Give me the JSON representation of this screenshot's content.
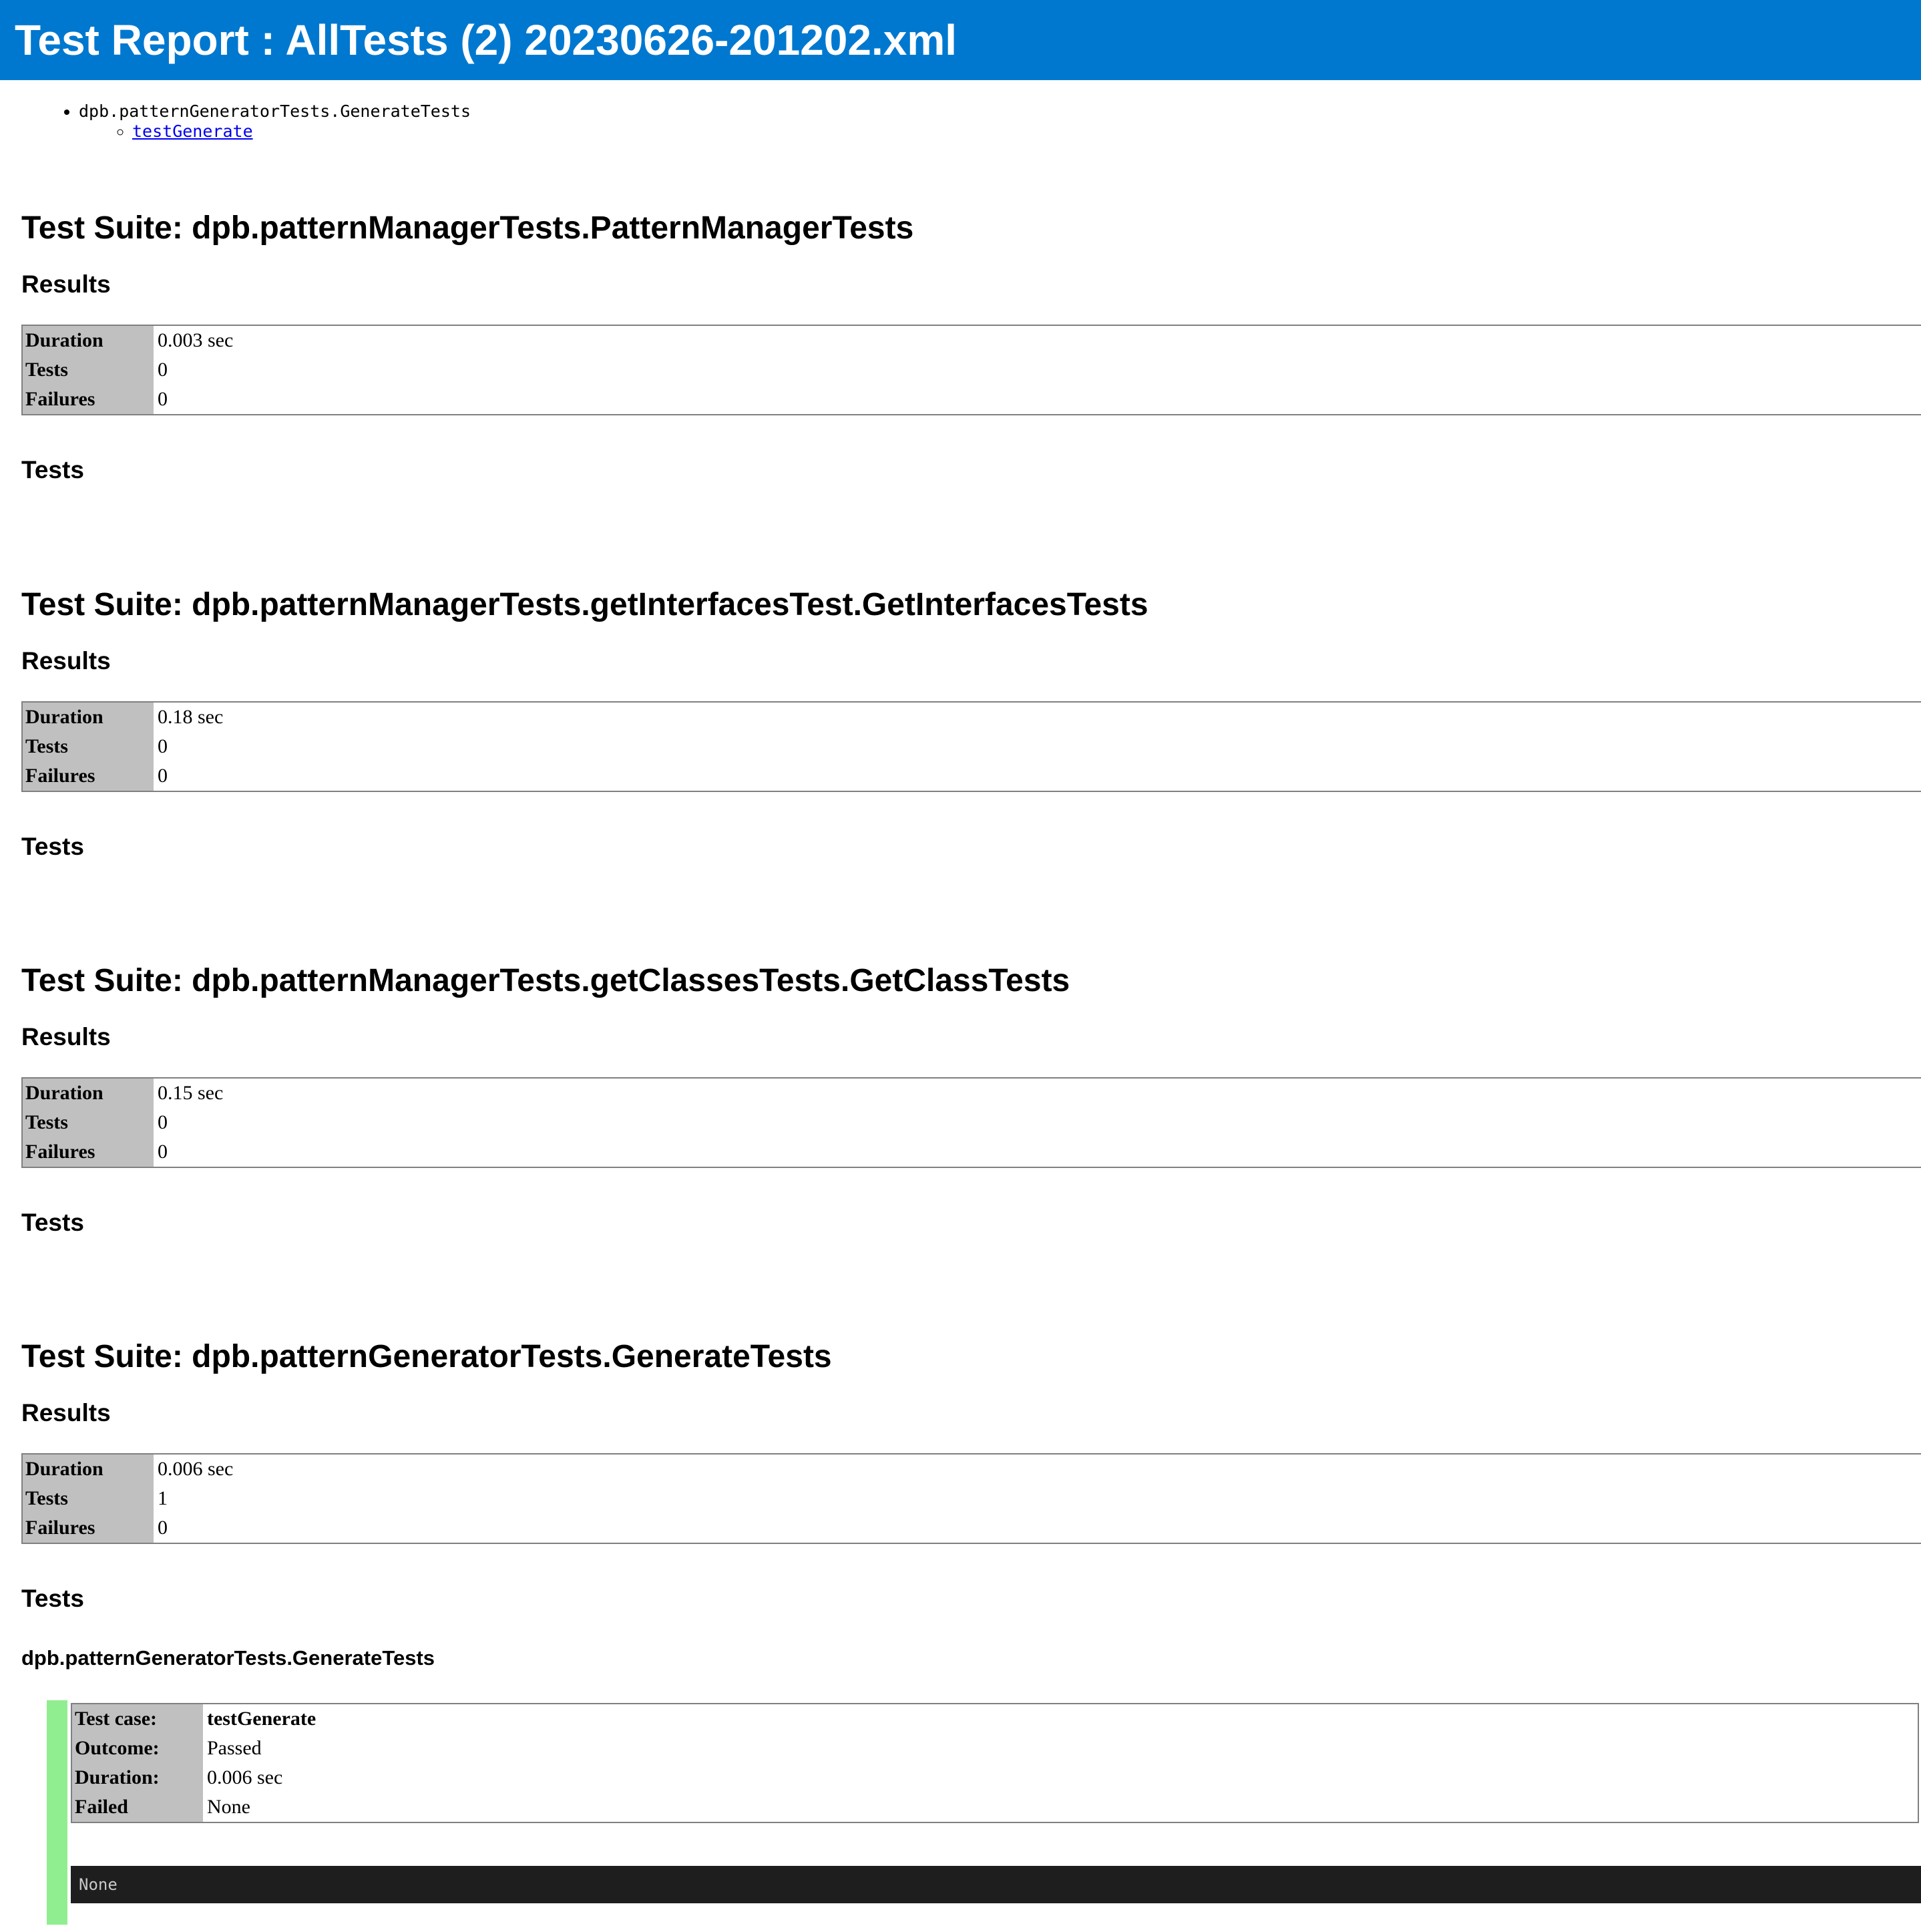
{
  "header": {
    "title": "Test Report : AllTests (2) 20230626-201202.xml"
  },
  "toc": {
    "suite": "dpb.patternGeneratorTests.GenerateTests",
    "test_link": "testGenerate"
  },
  "labels": {
    "results": "Results",
    "tests": "Tests",
    "duration": "Duration",
    "tests_row": "Tests",
    "failures": "Failures"
  },
  "suites": [
    {
      "title": "Test Suite: dpb.patternManagerTests.PatternManagerTests",
      "duration": "0.003 sec",
      "tests": "0",
      "failures": "0"
    },
    {
      "title": "Test Suite: dpb.patternManagerTests.getInterfacesTest.GetInterfacesTests",
      "duration": "0.18 sec",
      "tests": "0",
      "failures": "0"
    },
    {
      "title": "Test Suite: dpb.patternManagerTests.getClassesTests.GetClassTests",
      "duration": "0.15 sec",
      "tests": "0",
      "failures": "0"
    },
    {
      "title": "Test Suite: dpb.patternGeneratorTests.GenerateTests",
      "duration": "0.006 sec",
      "tests": "1",
      "failures": "0"
    }
  ],
  "test_class": "dpb.patternGeneratorTests.GenerateTests",
  "test_case": {
    "label_case": "Test case:",
    "name": "testGenerate",
    "label_outcome": "Outcome:",
    "outcome": "Passed",
    "label_duration": "Duration:",
    "duration": "0.006 sec",
    "label_failed": "Failed",
    "failed": "None",
    "console": "None"
  },
  "colors": {
    "header_bg": "#0078cf",
    "pass_bar": "#90ee90",
    "label_bg": "#c0c0c0",
    "console_bg": "#1e1e1e"
  }
}
